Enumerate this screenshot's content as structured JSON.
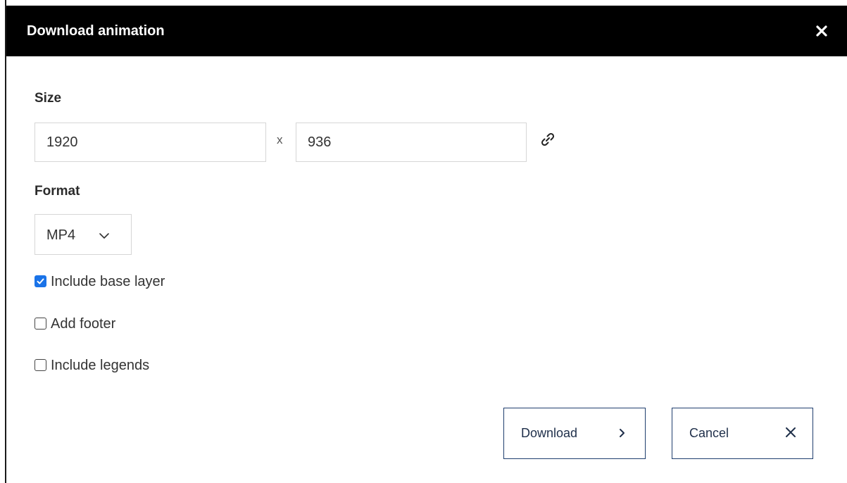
{
  "dialog": {
    "title": "Download animation"
  },
  "size": {
    "label": "Size",
    "width_value": "1920",
    "height_value": "936",
    "separator": "x"
  },
  "format": {
    "label": "Format",
    "selected": "MP4"
  },
  "options": [
    {
      "label": "Include base layer",
      "checked": true
    },
    {
      "label": "Add footer",
      "checked": false
    },
    {
      "label": "Include legends",
      "checked": false
    }
  ],
  "buttons": {
    "download_label": "Download",
    "cancel_label": "Cancel"
  },
  "icons": {
    "close": "close-icon",
    "link": "link-icon",
    "chevron": "chevron-down-icon",
    "download_arrow": "chevron-right-icon",
    "cancel": "x-icon"
  },
  "colors": {
    "titlebar": "#000000",
    "accent": "#1a73e8",
    "button_border": "#1f3e6e"
  }
}
